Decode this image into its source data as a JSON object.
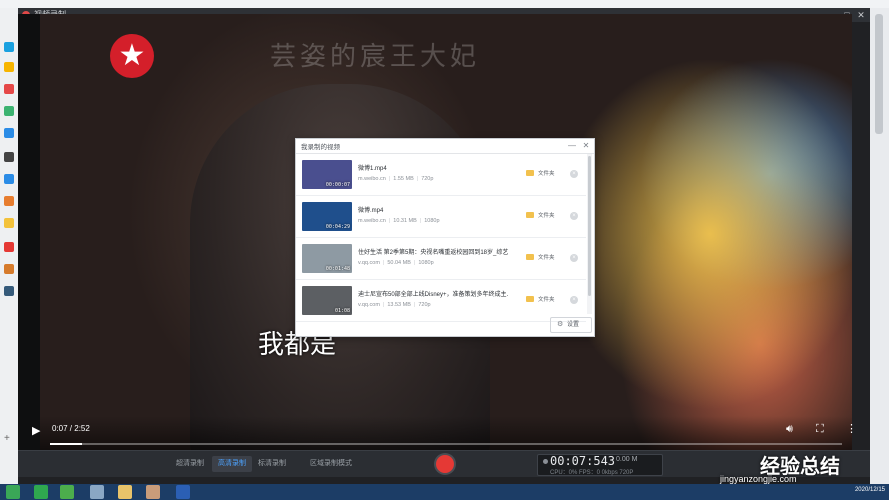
{
  "window": {
    "title": "视频录制",
    "min": "—",
    "max": "□",
    "close": "✕"
  },
  "video": {
    "watermark": "芸姿的宸王大妃",
    "subtitle": "我都是",
    "time": "0:07 / 2:52",
    "progress": 0.04
  },
  "player_icons": {
    "play": "play-icon",
    "volume": "volume-icon",
    "fullscreen": "fullscreen-icon",
    "more": "more-vertical-icon"
  },
  "dialog": {
    "title": "我录制的视频",
    "min": "—",
    "close": "✕",
    "settings_label": "设置",
    "items": [
      {
        "name": "微博1.mp4",
        "source": "m.weibo.cn",
        "size": "1.55 MB",
        "resolution": "720p",
        "duration": "00:00:07",
        "folder": "文件夹",
        "thumb_color": "#4a4f8f"
      },
      {
        "name": "微博.mp4",
        "source": "m.weibo.cn",
        "size": "10.31 MB",
        "resolution": "1080p",
        "duration": "00:04:29",
        "folder": "文件夹",
        "thumb_color": "#1f4f8c"
      },
      {
        "name": "住好生活 第2季第5期：央视名嘴重返校园回到18岁_综艺...",
        "source": "v.qq.com",
        "size": "50.04 MB",
        "resolution": "1080p",
        "duration": "00:01:48",
        "folder": "文件夹",
        "thumb_color": "#8e9aa3"
      },
      {
        "name": "迪士尼宣布50部全部上线Disney+，准备策划多年终成主...",
        "source": "v.qq.com",
        "size": "13.53 MB",
        "resolution": "720p",
        "duration": "01:08",
        "folder": "文件夹",
        "thumb_color": "#5c5f63"
      }
    ]
  },
  "toolbar": {
    "modes": [
      "超清录制",
      "高清录制",
      "标清录制",
      "区域录制模式"
    ],
    "active_mode_index": 1,
    "timer": "00:07:543",
    "timer_size": "0.00 M",
    "stats": "CPU：0%  FPS：0  0kbps  720P"
  },
  "brand": {
    "name": "经验总结",
    "url": "jingyanzongjie.com"
  },
  "clock": "2020/12/15",
  "colors": {
    "accent": "#4da3ff",
    "record": "#e53935",
    "folder": "#f2c14e"
  }
}
